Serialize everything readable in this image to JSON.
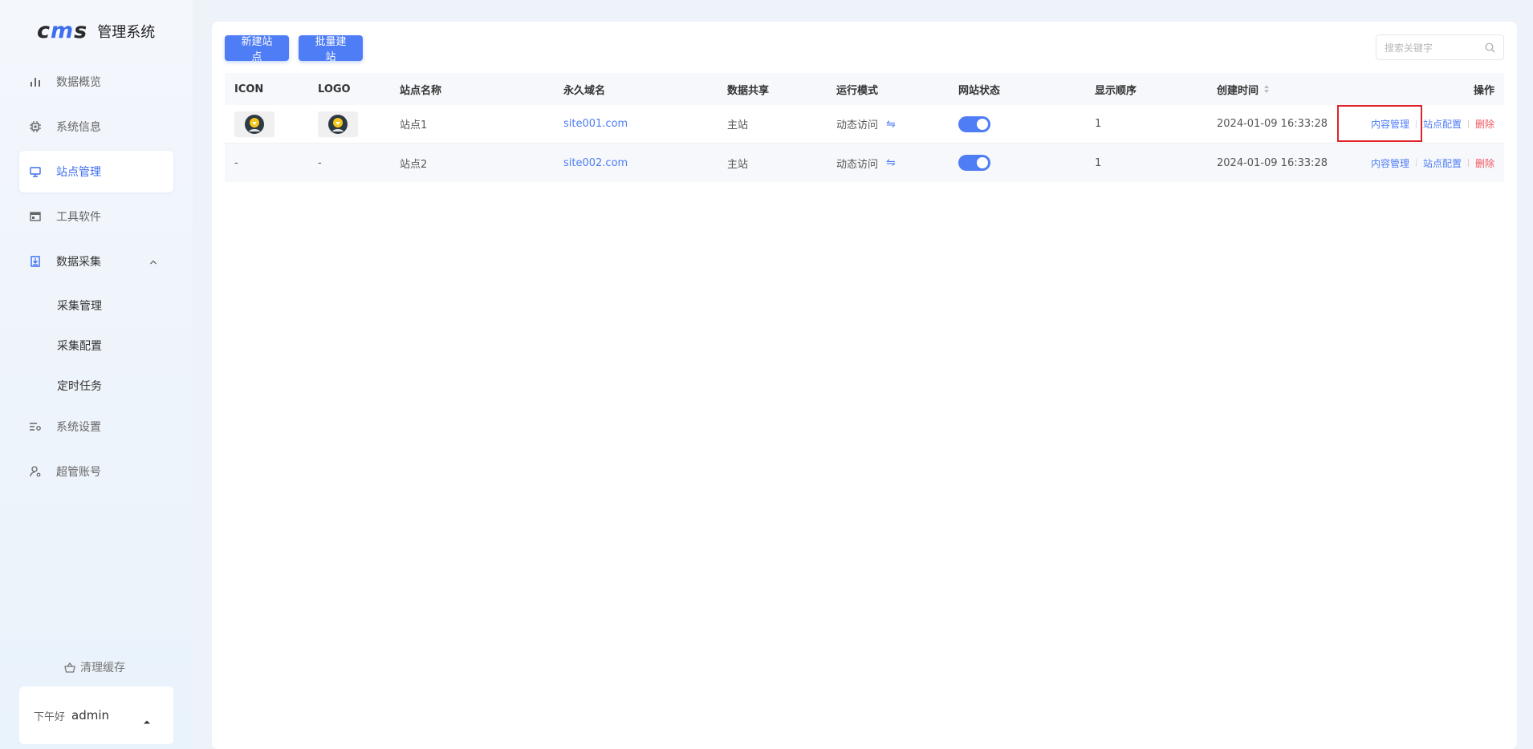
{
  "brand": {
    "logo_text": "cms",
    "title": "管理系统"
  },
  "sidebar": {
    "items": [
      {
        "label": "数据概览",
        "icon": "bar-chart-icon"
      },
      {
        "label": "系统信息",
        "icon": "chip-icon"
      },
      {
        "label": "站点管理",
        "icon": "monitor-icon",
        "active": true
      },
      {
        "label": "工具软件",
        "icon": "window-icon"
      },
      {
        "label": "数据采集",
        "icon": "download-box-icon",
        "open": true
      },
      {
        "label": "系统设置",
        "icon": "settings-list-icon"
      },
      {
        "label": "超管账号",
        "icon": "user-gear-icon"
      }
    ],
    "sub_items": [
      "采集管理",
      "采集配置",
      "定时任务"
    ],
    "clear_cache": "清理缓存",
    "greeting": "下午好",
    "username": "admin"
  },
  "toolbar": {
    "new_site": "新建站点",
    "batch_site": "批量建站",
    "search_placeholder": "搜索关键字"
  },
  "table": {
    "columns": [
      "ICON",
      "LOGO",
      "站点名称",
      "永久域名",
      "数据共享",
      "运行模式",
      "网站状态",
      "显示顺序",
      "创建时间",
      "操作"
    ],
    "rows": [
      {
        "icon": "",
        "logo": "",
        "name": "站点1",
        "domain": "site001.com",
        "share": "主站",
        "mode": "动态访问",
        "status": true,
        "order": "1",
        "created": "2024-01-09 16:33:28"
      },
      {
        "icon": "-",
        "logo": "-",
        "name": "站点2",
        "domain": "site002.com",
        "share": "主站",
        "mode": "动态访问",
        "status": true,
        "order": "1",
        "created": "2024-01-09 16:33:28"
      }
    ],
    "ops": {
      "content": "内容管理",
      "config": "站点配置",
      "delete": "删除"
    }
  },
  "colors": {
    "accent": "#4f7df5",
    "danger": "#f0565e",
    "highlight": "#e0232b"
  }
}
